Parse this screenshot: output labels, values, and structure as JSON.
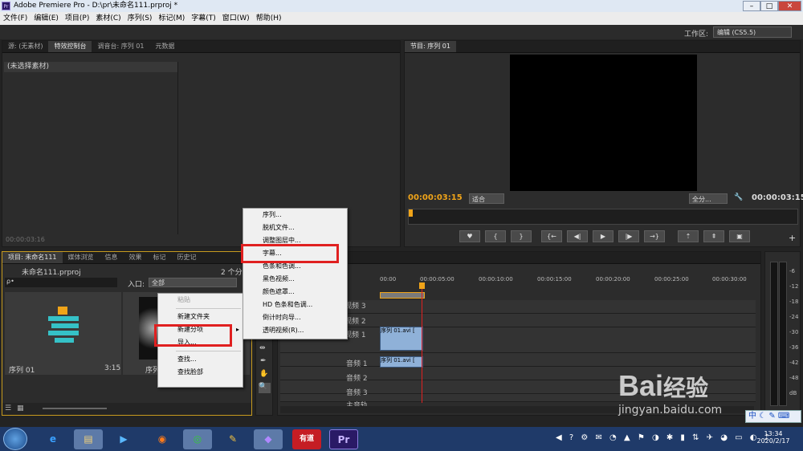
{
  "window": {
    "title": "Adobe Premiere Pro - D:\\pr\\未命名111.prproj *",
    "app_icon": "Pr",
    "min": "–",
    "max": "□",
    "close": "✕"
  },
  "menu": [
    "文件(F)",
    "编辑(E)",
    "项目(P)",
    "素材(C)",
    "序列(S)",
    "标记(M)",
    "字幕(T)",
    "窗口(W)",
    "帮助(H)"
  ],
  "workspace": {
    "label": "工作区:",
    "value": "编辑 (CS5.5)"
  },
  "source_panel": {
    "tabs": [
      "源: (无素材)",
      "特效控制台",
      "调音台: 序列 01",
      "元数据"
    ],
    "header": "(未选择素材)",
    "timecode": "00:00:03:16"
  },
  "program": {
    "tab": "节目: 序列 01",
    "timecode_left": "00:00:03:15",
    "fit": "适合",
    "full": "全分...",
    "timecode_right": "00:00:03:15"
  },
  "project": {
    "tabs": [
      "项目: 未命名111",
      "媒体浏览",
      "信息",
      "效果",
      "标记",
      "历史记"
    ],
    "file": "未命名111.prproj",
    "count": "2 个分",
    "search_placeholder": "ρ•",
    "entry_label": "入口:",
    "entry_value": "全部",
    "items": [
      {
        "name": "序列 01",
        "duration": "3:15"
      },
      {
        "name": "序列 01.a"
      }
    ]
  },
  "context_menu": {
    "items": [
      "粘贴",
      "新建文件夹",
      "新建分项",
      "导入...",
      "查找...",
      "查找脸部"
    ]
  },
  "submenu": {
    "items": [
      "序列...",
      "脱机文件...",
      "调整图层中...",
      "字幕...",
      "色条和色调...",
      "黑色视频...",
      "颜色遮罩...",
      "HD 色条和色调...",
      "倒计时向导...",
      "透明视频(R)..."
    ]
  },
  "timeline": {
    "ruler": [
      "00:00",
      "00:00:05:00",
      "00:00:10:00",
      "00:00:15:00",
      "00:00:20:00",
      "00:00:25:00",
      "00:00:30:00"
    ],
    "tracks": [
      "视频 3",
      "视频 2",
      "视频 1",
      "音频 1",
      "音频 2",
      "音频 3",
      "主音轨"
    ],
    "clip_video": "序列 01.avi [",
    "clip_audio": "序列 01.avi ["
  },
  "meter": {
    "labels": [
      "-6",
      "-12",
      "-18",
      "-24",
      "-30",
      "-36",
      "-42",
      "-48",
      "dB"
    ]
  },
  "watermark": {
    "brand": "Bai",
    "brand_cn": "经验",
    "url": "jingyan.baidu.com"
  },
  "ime": {
    "label": "中"
  },
  "taskbar": {
    "time": "13:34",
    "date": "2020/2/17",
    "apps": [
      "e",
      "▤",
      "▶",
      "◉",
      "◎",
      "✎",
      "◆",
      "有道",
      "Pr"
    ]
  }
}
